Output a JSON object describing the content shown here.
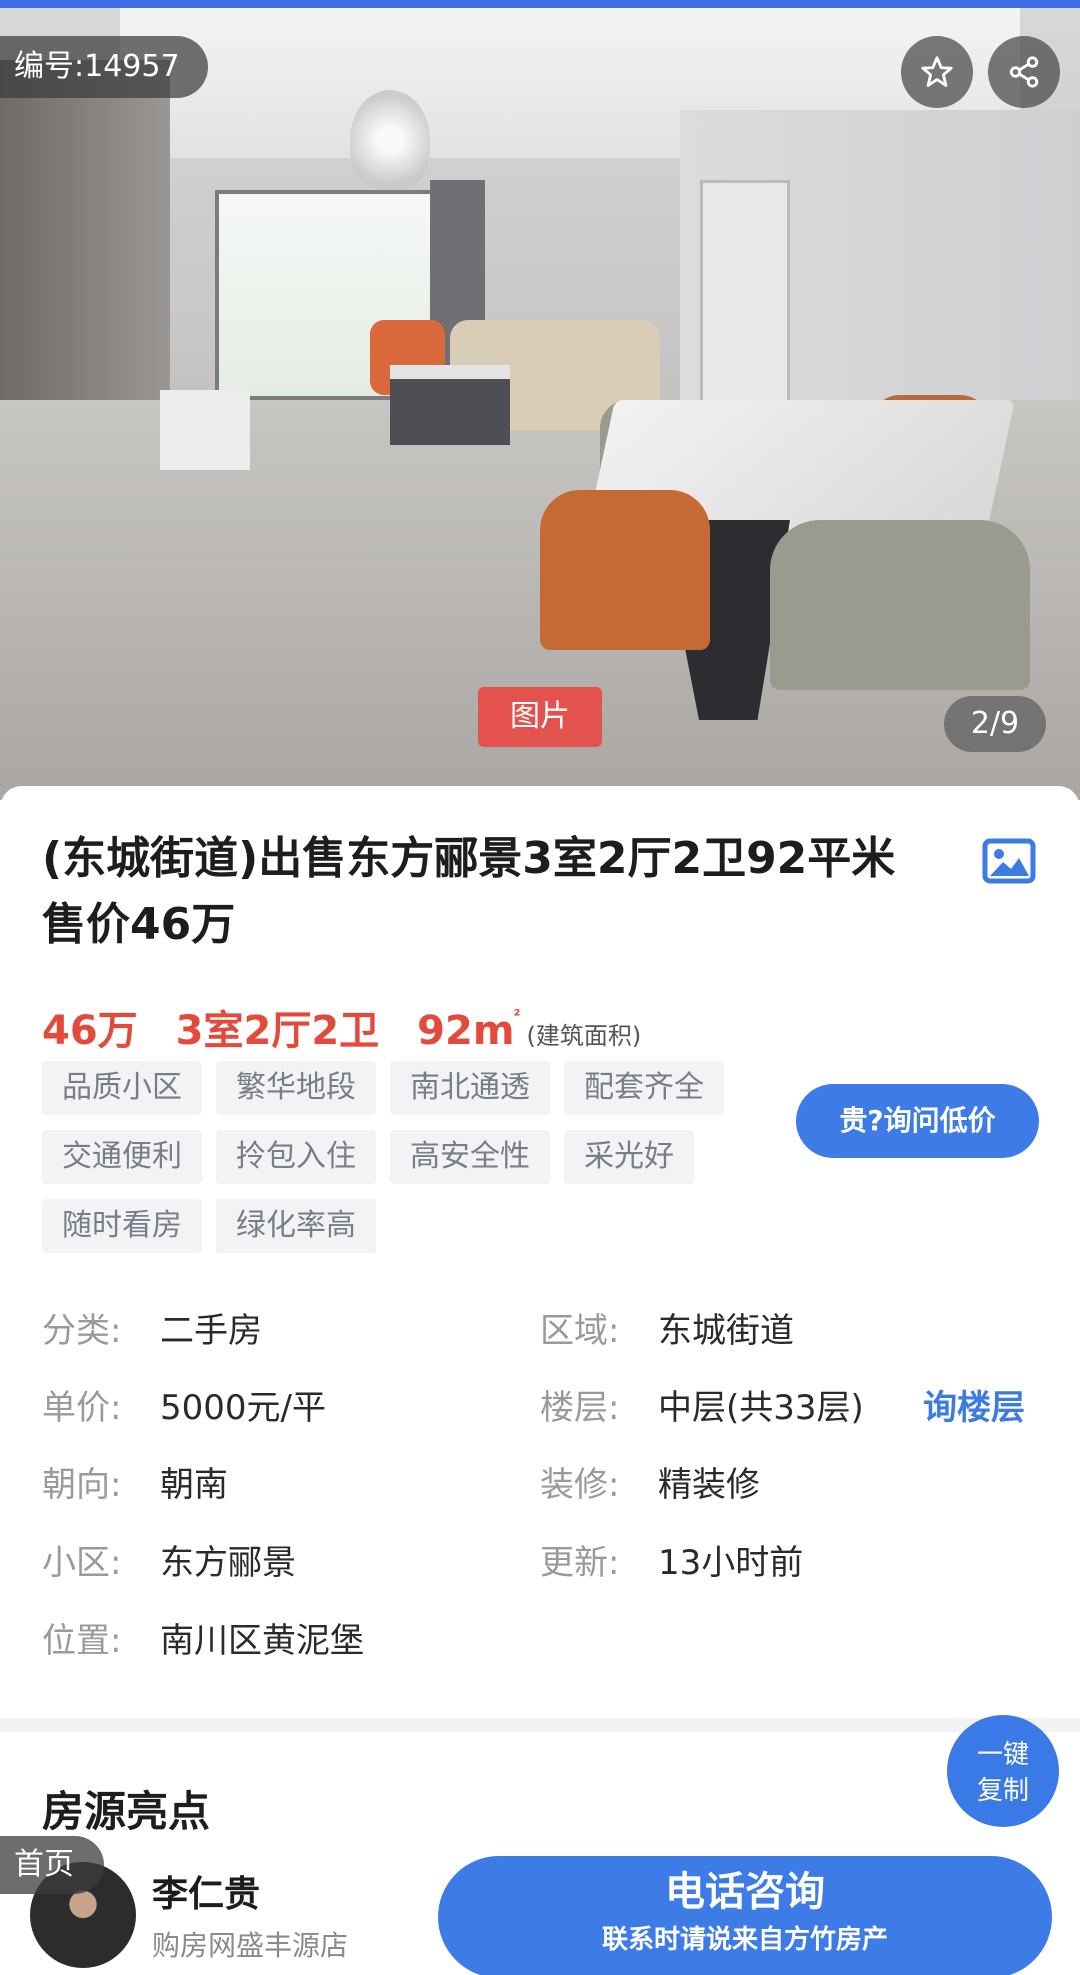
{
  "photo": {
    "id_label": "编号:14957",
    "tag": "图片",
    "counter": "2/9",
    "favorite_icon": "star-icon",
    "share_icon": "share-icon"
  },
  "listing": {
    "title": "(东城街道)出售东方郦景3室2厅2卫92平米 售价46万",
    "gallery_icon": "image-icon",
    "price": "46万",
    "layout": "3室2厅2卫",
    "area": "92m",
    "area_sup": "²",
    "area_note": "(建筑面积)",
    "tags": [
      "品质小区",
      "繁华地段",
      "南北通透",
      "配套齐全",
      "交通便利",
      "拎包入住",
      "高安全性",
      "采光好",
      "随时看房",
      "绿化率高"
    ],
    "ask_price_button": "贵?询问低价"
  },
  "info": {
    "category_label": "分类:",
    "category": "二手房",
    "region_label": "区域:",
    "region": "东城街道",
    "unit_price_label": "单价:",
    "unit_price": "5000元/平",
    "floor_label": "楼层:",
    "floor": "中层(共33层)",
    "ask_floor": "询楼层",
    "orientation_label": "朝向:",
    "orientation": "朝南",
    "decoration_label": "装修:",
    "decoration": "精装修",
    "community_label": "小区:",
    "community": "东方郦景",
    "updated_label": "更新:",
    "updated": "13小时前",
    "location_label": "位置:",
    "location": "南川区黄泥堡"
  },
  "section": {
    "highlights_title": "房源亮点",
    "copy_button_line1": "一键",
    "copy_button_line2": "复制"
  },
  "bottom_bar": {
    "home_label": "首页",
    "agent_name": "李仁贵",
    "agent_shop": "购房网盛丰源店",
    "call_label": "电话咨询",
    "call_sub": "联系时请说来自方竹房产"
  }
}
